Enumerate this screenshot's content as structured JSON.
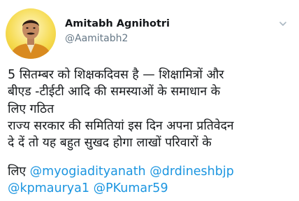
{
  "author": {
    "display_name": "Amitabh Agnihotri",
    "handle": "@Aamitabh2"
  },
  "icons": {
    "more": "chevron-down-icon",
    "avatar": "profile-photo"
  },
  "colors": {
    "link": "#1b95e0",
    "text": "#14171a",
    "secondary": "#657786",
    "avatar_bg": "#f6dc55"
  },
  "tweet": {
    "body": "5 सितम्बर को शिक्षकदिवस है — शिक्षामित्रों और\nबीएड -टीईटी आदि की समस्याओं के समाधान के\nलिए गठित\nराज्य सरकार की समितियां इस दिन अपना प्रतिवेदन\nदे दें तो यह बहुत सुखद होगा लाखों परिवारों के",
    "trailing_text": "लिए",
    "mentions": [
      "@myogiadityanath",
      "@drdineshbjp",
      "@kpmaurya1",
      "@PKumar59"
    ]
  }
}
